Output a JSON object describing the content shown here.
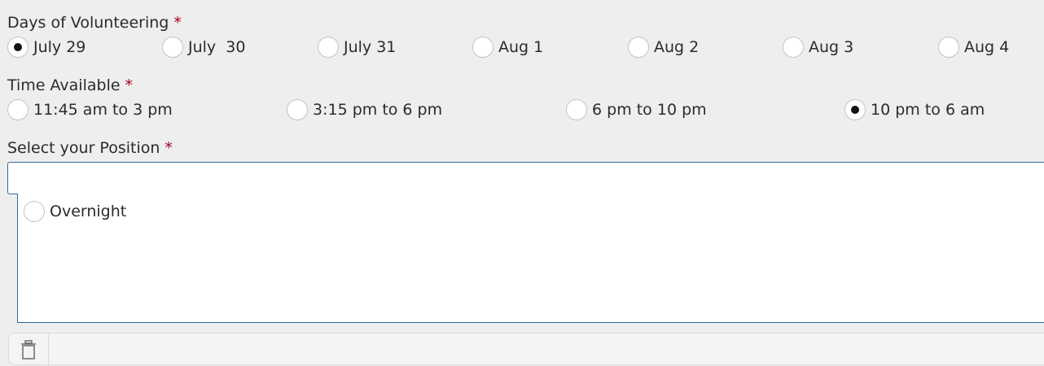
{
  "days": {
    "label": "Days of Volunteering",
    "required_mark": "*",
    "options": [
      {
        "label": "July 29",
        "checked": true
      },
      {
        "label": "July  30",
        "checked": false
      },
      {
        "label": "July 31",
        "checked": false
      },
      {
        "label": "Aug 1",
        "checked": false
      },
      {
        "label": "Aug 2",
        "checked": false
      },
      {
        "label": "Aug 3",
        "checked": false
      },
      {
        "label": "Aug 4",
        "checked": false
      }
    ]
  },
  "time": {
    "label": "Time Available",
    "required_mark": "*",
    "options": [
      {
        "label": "11:45 am to 3 pm",
        "checked": false
      },
      {
        "label": "3:15 pm to 6 pm",
        "checked": false
      },
      {
        "label": "6 pm to 10 pm",
        "checked": false
      },
      {
        "label": "10 pm to 6 am",
        "checked": true
      }
    ]
  },
  "position": {
    "label": "Select your Position",
    "required_mark": "*",
    "input_value": "",
    "options": [
      {
        "label": "Overnight",
        "checked": false
      }
    ]
  },
  "toolbar": {
    "icon": "trash-icon"
  },
  "colors": {
    "background": "#edeeee",
    "required": "#a8001f",
    "input_border": "#35679c",
    "radio_dot": "#111111"
  }
}
